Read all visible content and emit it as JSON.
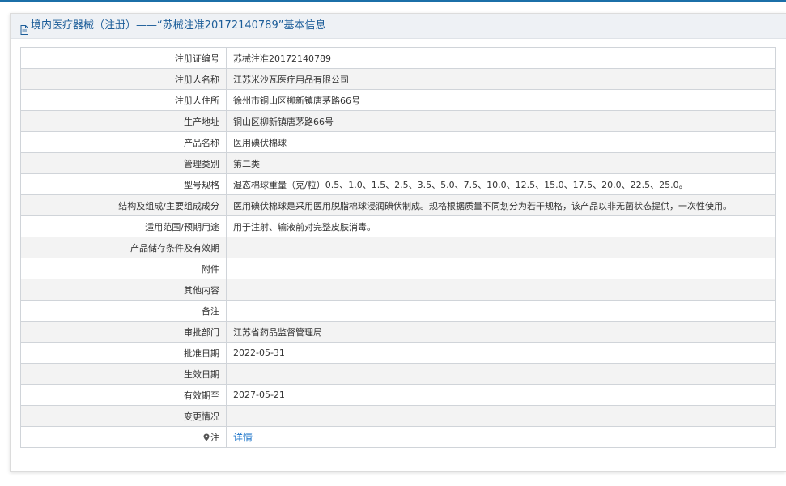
{
  "header": {
    "title": "境内医疗器械（注册）——“苏械注准20172140789”基本信息"
  },
  "rows": [
    {
      "label": "注册证编号",
      "value": "苏械注准20172140789"
    },
    {
      "label": "注册人名称",
      "value": "江苏米沙瓦医疗用品有限公司"
    },
    {
      "label": "注册人住所",
      "value": "徐州市铜山区柳新镇唐茅路66号"
    },
    {
      "label": "生产地址",
      "value": "铜山区柳新镇唐茅路66号"
    },
    {
      "label": "产品名称",
      "value": "医用碘伏棉球"
    },
    {
      "label": "管理类别",
      "value": "第二类"
    },
    {
      "label": "型号规格",
      "value": "湿态棉球重量（克/粒）0.5、1.0、1.5、2.5、3.5、5.0、7.5、10.0、12.5、15.0、17.5、20.0、22.5、25.0。"
    },
    {
      "label": "结构及组成/主要组成成分",
      "value": "医用碘伏棉球是采用医用脱脂棉球浸润碘伏制成。规格根据质量不同划分为若干规格，该产品以非无菌状态提供，一次性使用。"
    },
    {
      "label": "适用范围/预期用途",
      "value": "用于注射、输液前对完整皮肤消毒。"
    },
    {
      "label": "产品储存条件及有效期",
      "value": ""
    },
    {
      "label": "附件",
      "value": ""
    },
    {
      "label": "其他内容",
      "value": ""
    },
    {
      "label": "备注",
      "value": ""
    },
    {
      "label": "审批部门",
      "value": "江苏省药品监督管理局"
    },
    {
      "label": "批准日期",
      "value": "2022-05-31"
    },
    {
      "label": "生效日期",
      "value": ""
    },
    {
      "label": "有效期至",
      "value": "2027-05-21"
    },
    {
      "label": "变更情况",
      "value": ""
    }
  ],
  "note_row": {
    "label": "注",
    "link_text": "详情"
  },
  "colors": {
    "accent": "#1c5d99",
    "link": "#1a73c9",
    "header_bg": "#eef1f5",
    "row_alt_bg": "#f3f3f3",
    "border": "#d0d4d9"
  },
  "icons": {
    "header_icon": "document-icon",
    "note_icon": "pin-icon"
  }
}
